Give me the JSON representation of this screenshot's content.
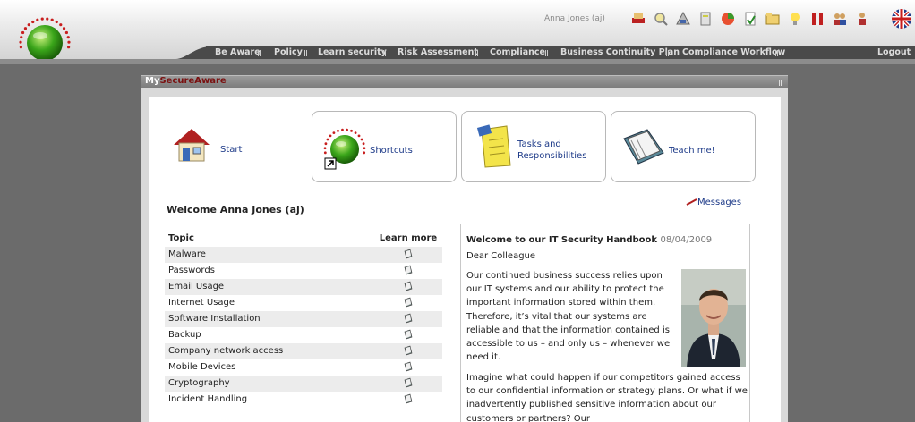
{
  "header": {
    "user": "Anna Jones (aj)",
    "toolbar_icons": [
      "user-icon",
      "search-icon",
      "award-icon",
      "tools-icon",
      "chart-icon",
      "document-icon",
      "folder-icon",
      "lightbulb-icon",
      "bookmark-icon",
      "group-icon",
      "person-icon"
    ],
    "language_icon": "uk-flag-icon"
  },
  "nav": {
    "items": [
      "Be Aware",
      "Policy",
      "Learn security",
      "Risk Assessment",
      "Compliance",
      "Business Continuity Plan",
      "Compliance Workflow"
    ],
    "logout": "Logout"
  },
  "panel": {
    "title_prefix": "My",
    "title_main": "SecureAware"
  },
  "shortcuts": {
    "start": "Start",
    "shortcuts": "Shortcuts",
    "tasks_line1": "Tasks and",
    "tasks_line2": "Responsibilities",
    "teach": "Teach me!"
  },
  "welcome": "Welcome Anna Jones (aj)",
  "messages": "Messages",
  "topics": {
    "header_topic": "Topic",
    "header_learn": "Learn more",
    "rows": [
      "Malware",
      "Passwords",
      "Email Usage",
      "Internet Usage",
      "Software Installation",
      "Backup",
      "Company network access",
      "Mobile Devices",
      "Cryptography",
      "Incident Handling"
    ]
  },
  "article": {
    "title": "Welcome to our IT Security Handbook",
    "date": "08/04/2009",
    "greeting": "Dear Colleague",
    "para1": "Our continued business success relies upon our IT systems and our ability to protect the important information stored within them. Therefore, it’s vital that our systems are reliable and that the information contained is accessible to us – and only us – whenever we need it.",
    "para2": "Imagine what could happen if our competitors gained access to our confidential information or strategy plans. Or what if we inadvertently published sensitive information about our customers or partners? Our"
  },
  "colors": {
    "brand_red": "#7a1010",
    "link_blue": "#1d3a88",
    "nav_dark": "#4a4a4a",
    "background": "#6b6b6b"
  }
}
